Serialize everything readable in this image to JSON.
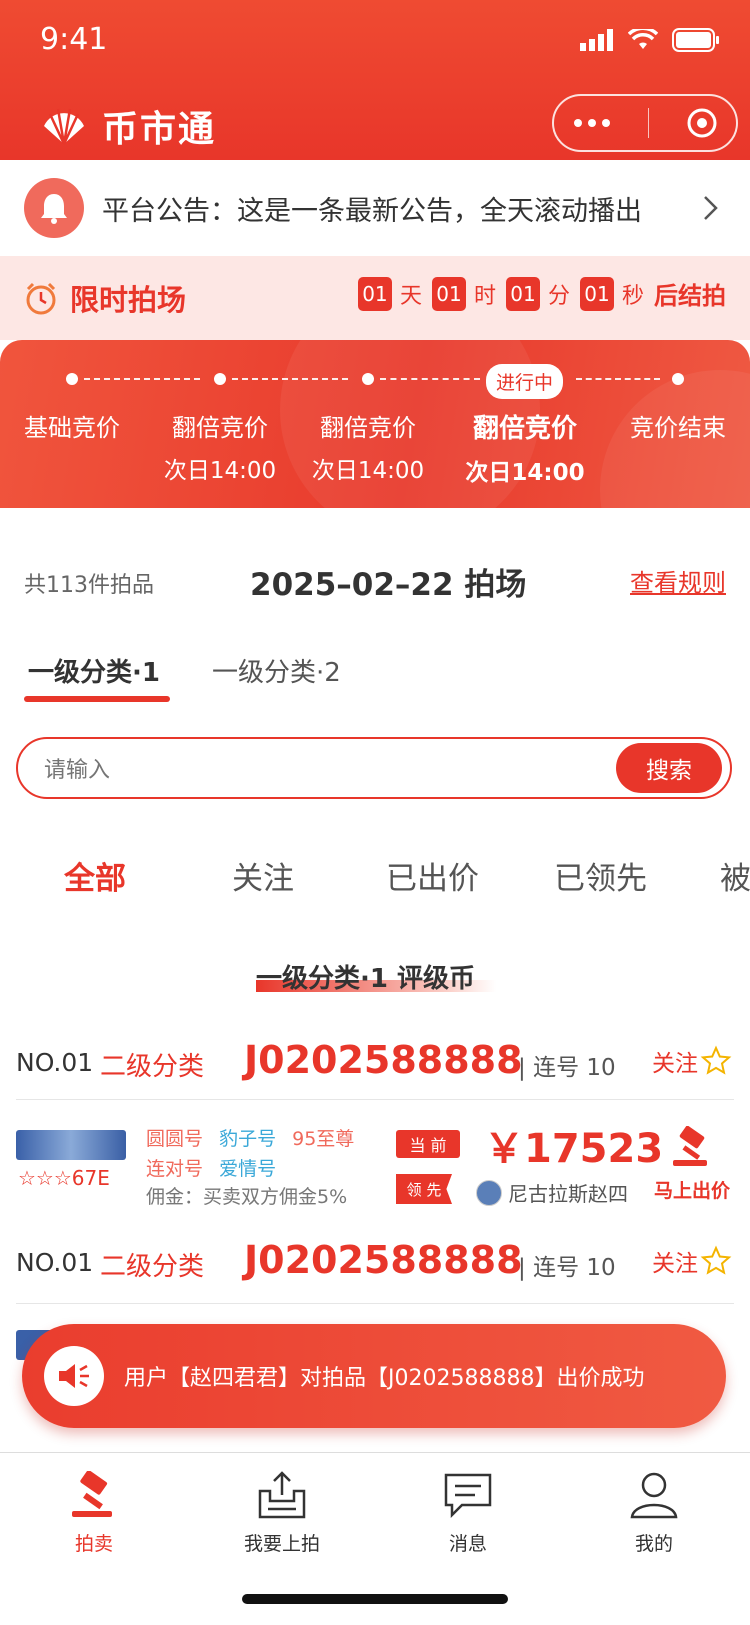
{
  "status": {
    "time": "9:41"
  },
  "app": {
    "title": "币市通"
  },
  "notice": {
    "text": "平台公告：这是一条最新公告，全天滚动播出"
  },
  "flash": {
    "title": "限时拍场",
    "countdown": [
      {
        "value": "01",
        "unit": "天"
      },
      {
        "value": "01",
        "unit": "时"
      },
      {
        "value": "01",
        "unit": "分"
      },
      {
        "value": "01",
        "unit": "秒"
      }
    ],
    "end_label": "后结拍"
  },
  "stages": {
    "active_badge": "进行中",
    "items": [
      {
        "name": "基础竞价",
        "time": ""
      },
      {
        "name": "翻倍竞价",
        "time": "次日14:00"
      },
      {
        "name": "翻倍竞价",
        "time": "次日14:00"
      },
      {
        "name": "翻倍竞价",
        "time": "次日14:00"
      },
      {
        "name": "竞价结束",
        "time": ""
      }
    ]
  },
  "meta": {
    "count": "共113件拍品",
    "session": "2025–02–22 拍场",
    "rules": "查看规则"
  },
  "category_tabs": [
    "一级分类·1",
    "一级分类·2"
  ],
  "search": {
    "placeholder": "请输入",
    "button": "搜索"
  },
  "filter_tabs": [
    "全部",
    "关注",
    "已出价",
    "已领先",
    "被"
  ],
  "section": {
    "title": "一级分类·1 评级币"
  },
  "items": [
    {
      "no": "NO.01",
      "category": "二级分类",
      "code": "J0202588888",
      "lianhao": "连号 10",
      "follow": "关注",
      "stars_text": "☆☆☆67E",
      "tags_row1": [
        {
          "text": "圆圆号",
          "color": "red"
        },
        {
          "text": "豹子号",
          "color": "blue"
        },
        {
          "text": "95至尊",
          "color": "red"
        }
      ],
      "tags_row2": [
        {
          "text": "连对号",
          "color": "red"
        },
        {
          "text": "爱情号",
          "color": "blue"
        }
      ],
      "fee": "佣金：买卖双方佣金5%",
      "current_label": "当 前",
      "price": "￥17523",
      "lead_label": "领 先",
      "bidder": "尼古拉斯赵四",
      "bid_button": "马上出价"
    },
    {
      "no": "NO.01",
      "category": "二级分类",
      "code": "J0202588888",
      "lianhao": "连号 10",
      "follow": "关注"
    }
  ],
  "toast": {
    "text": "用户【赵四君君】对拍品【J0202588888】出价成功"
  },
  "tabbar": [
    {
      "label": "拍卖",
      "icon": "gavel-icon",
      "active": true
    },
    {
      "label": "我要上拍",
      "icon": "upload-box-icon",
      "active": false
    },
    {
      "label": "消息",
      "icon": "message-icon",
      "active": false
    },
    {
      "label": "我的",
      "icon": "user-icon",
      "active": false
    }
  ],
  "colors": {
    "brand": "#e8362a",
    "accent_light": "#fde7e4",
    "tag_blue": "#3aa8d8"
  }
}
